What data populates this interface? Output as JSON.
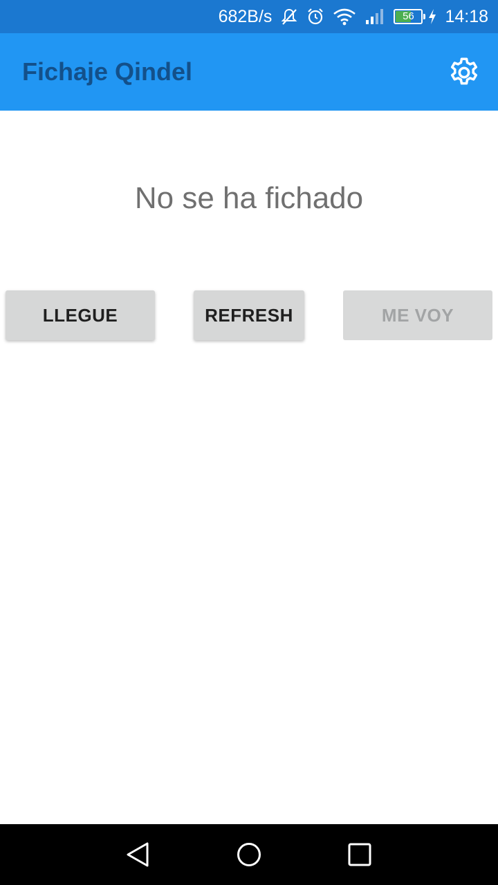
{
  "status_bar": {
    "network_speed": "682B/s",
    "battery_level": "56",
    "time": "14:18",
    "icons": [
      "mute-icon",
      "alarm-icon",
      "wifi-icon",
      "signal-icon",
      "battery-icon",
      "charging-icon"
    ]
  },
  "app_bar": {
    "title": "Fichaje Qindel",
    "settings_icon": "gear-icon"
  },
  "main": {
    "status_message": "No se ha fichado",
    "buttons": {
      "llegue": "LLEGUE",
      "refresh": "REFRESH",
      "me_voy": "ME VOY"
    },
    "me_voy_disabled": true
  },
  "nav_bar": {
    "icons": [
      "back-icon",
      "home-icon",
      "recent-apps-icon"
    ]
  },
  "colors": {
    "status_bar": "#1b78d0",
    "app_bar": "#2196f3",
    "title_text": "#13508a",
    "button_bg": "#d6d7d7",
    "disabled_text": "#a2a4a5",
    "message_text": "#707070"
  }
}
